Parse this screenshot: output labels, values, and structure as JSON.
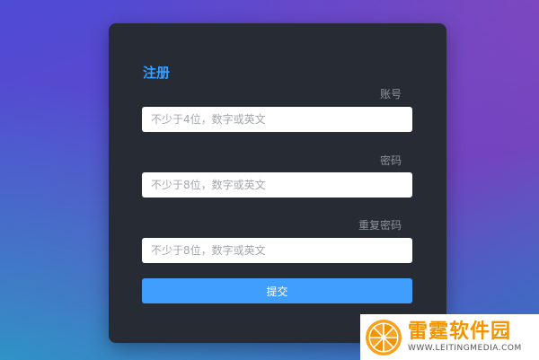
{
  "form": {
    "title": "注册",
    "fields": [
      {
        "label": "账号",
        "value": "",
        "placeholder": "不少于4位，数字或英文"
      },
      {
        "label": "密码",
        "value": "",
        "placeholder": "不少于8位，数字或英文"
      },
      {
        "label": "重复密码",
        "value": "",
        "placeholder": "不少于8位，数字或英文"
      }
    ],
    "submit_label": "提交"
  },
  "watermark": {
    "name": "雷霆软件园",
    "url": "WWW.LEITINGMEDIA.COM",
    "icon": "orange-slice-icon"
  },
  "colors": {
    "accent": "#409eff",
    "title": "#3aa0ff",
    "card": "#272b33",
    "watermark_orange": "#f29400"
  }
}
